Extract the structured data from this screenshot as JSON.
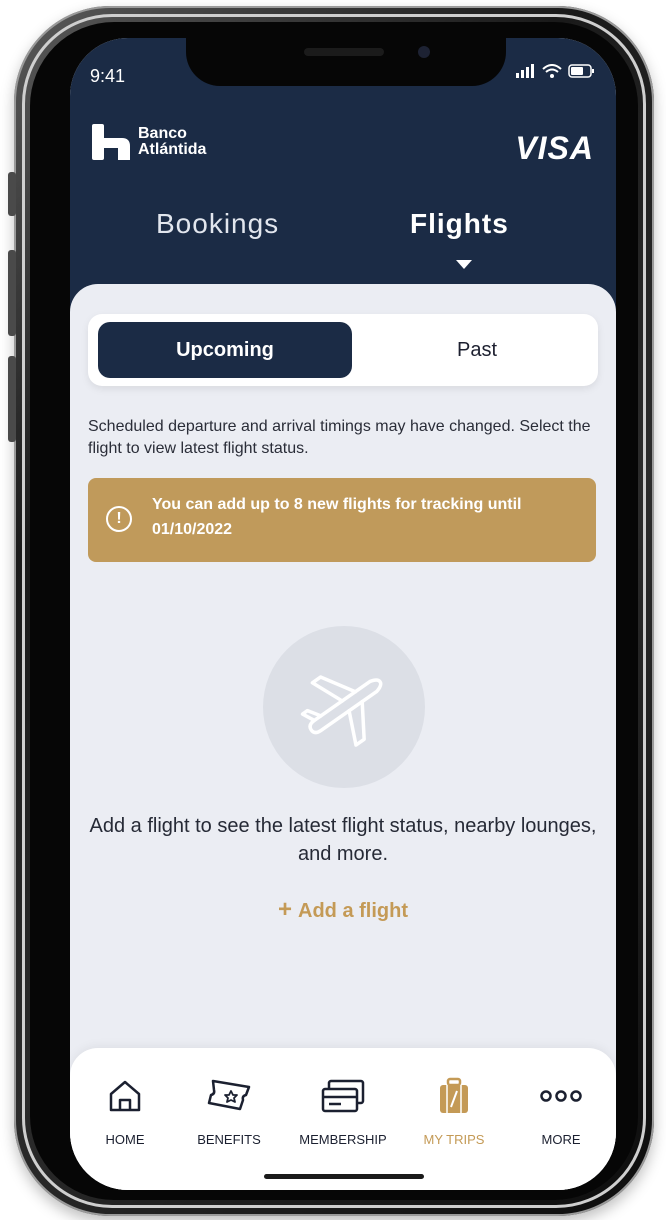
{
  "status_bar": {
    "time": "9:41"
  },
  "header": {
    "brand_name": "Banco\nAtlántida",
    "card_brand": "VISA"
  },
  "tabs": [
    {
      "label": "Bookings",
      "active": false
    },
    {
      "label": "Flights",
      "active": true
    }
  ],
  "segment": {
    "upcoming_label": "Upcoming",
    "past_label": "Past",
    "selected": "Upcoming"
  },
  "notice_text": "Scheduled departure and arrival timings may have changed. Select the flight to view latest flight status.",
  "alert": {
    "icon": "info-icon",
    "text": "You can add up to 8 new flights for tracking until 01/10/2022"
  },
  "empty_state": {
    "icon": "airplane-icon",
    "message": "Add a flight to see the latest flight status, nearby lounges, and more.",
    "action_label": "Add a flight"
  },
  "bottom_nav": [
    {
      "label": "HOME",
      "icon": "home-icon",
      "active": false
    },
    {
      "label": "BENEFITS",
      "icon": "ticket-icon",
      "active": false
    },
    {
      "label": "MEMBERSHIP",
      "icon": "card-icon",
      "active": false
    },
    {
      "label": "MY TRIPS",
      "icon": "luggage-icon",
      "active": true
    },
    {
      "label": "MORE",
      "icon": "more-icon",
      "active": false
    }
  ],
  "colors": {
    "primary_navy": "#1b2b45",
    "accent_gold": "#c49a56",
    "alert_gold": "#c09a5b",
    "background": "#ebedf3"
  }
}
